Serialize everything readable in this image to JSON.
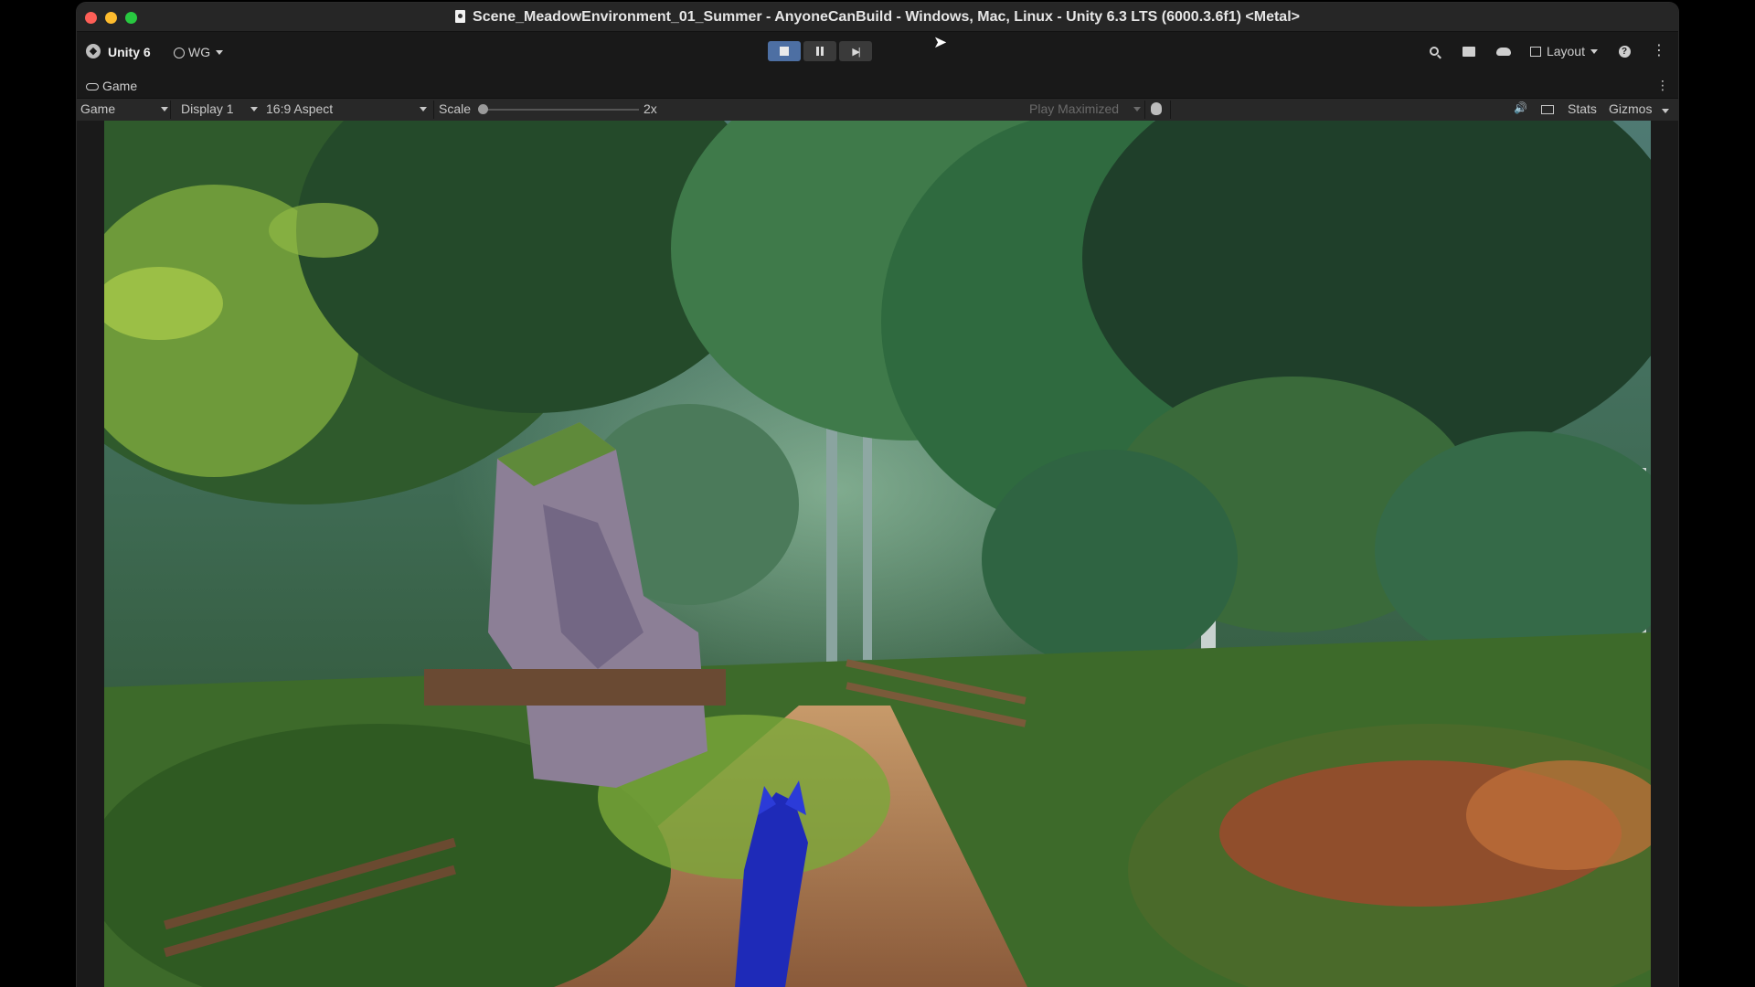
{
  "window": {
    "title": "Scene_MeadowEnvironment_01_Summer - AnyoneCanBuild - Windows, Mac, Linux - Unity 6.3 LTS (6000.3.6f1) <Metal>"
  },
  "toolbar": {
    "product_label": "Unity 6",
    "account_label": "WG",
    "layout_label": "Layout",
    "icons": [
      "unity-logo-icon",
      "account-icon",
      "stop-icon",
      "pause-icon",
      "step-icon",
      "search-icon",
      "package-icon",
      "cloud-icon",
      "layout-icon",
      "help-icon",
      "more-icon"
    ]
  },
  "tab": {
    "label": "Game"
  },
  "game_bar": {
    "view_dropdown": "Game",
    "display_dropdown": "Display 1",
    "aspect_dropdown": "16:9 Aspect",
    "scale_label": "Scale",
    "scale_value": "2x",
    "scale_fraction": 0.0,
    "play_mode_dropdown": "Play Maximized",
    "stats_label": "Stats",
    "gizmos_label": "Gizmos"
  },
  "colors": {
    "play_active": "#4d6fa3",
    "chrome_dark": "#191919",
    "bar": "#282828"
  }
}
